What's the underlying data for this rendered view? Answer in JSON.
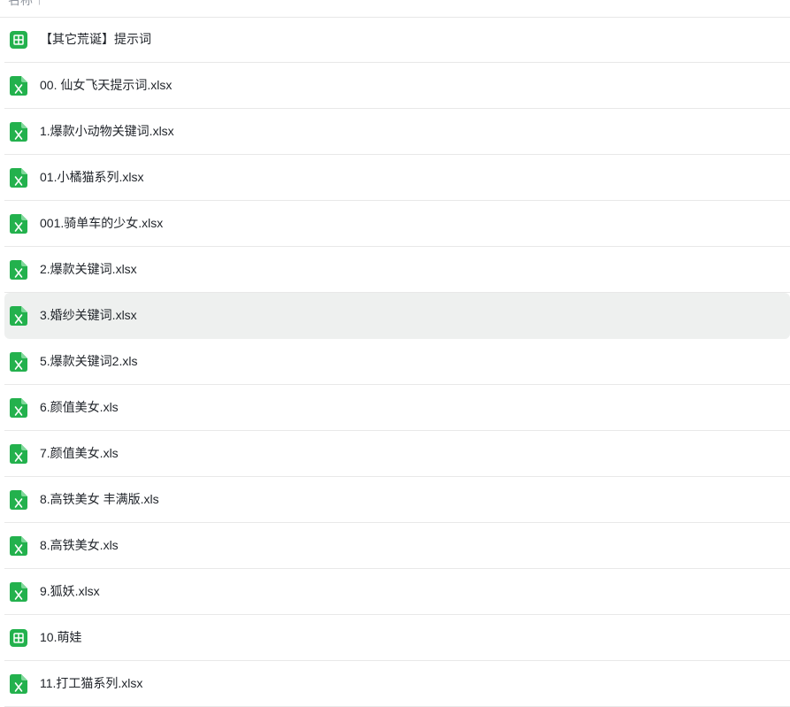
{
  "header": {
    "column_name": "名称 ↑"
  },
  "colors": {
    "file_green": "#23b14d",
    "selected_bg": "#eef0ef",
    "divider": "#e8e8e8"
  },
  "files": [
    {
      "name": "【其它荒诞】提示词",
      "icon": "sheet-icon"
    },
    {
      "name": "00. 仙女飞天提示词.xlsx",
      "icon": "excel-icon"
    },
    {
      "name": "1.爆款小动物关键词.xlsx",
      "icon": "excel-icon"
    },
    {
      "name": "01.小橘猫系列.xlsx",
      "icon": "excel-icon"
    },
    {
      "name": "001.骑单车的少女.xlsx",
      "icon": "excel-icon"
    },
    {
      "name": "2.爆款关键词.xlsx",
      "icon": "excel-icon"
    },
    {
      "name": "3.婚纱关键词.xlsx",
      "icon": "excel-icon",
      "selected": true
    },
    {
      "name": "5.爆款关键词2.xls",
      "icon": "excel-icon"
    },
    {
      "name": "6.颜值美女.xls",
      "icon": "excel-icon"
    },
    {
      "name": "7.颜值美女.xls",
      "icon": "excel-icon"
    },
    {
      "name": "8.高铁美女 丰满版.xls",
      "icon": "excel-icon"
    },
    {
      "name": "8.高铁美女.xls",
      "icon": "excel-icon"
    },
    {
      "name": "9.狐妖.xlsx",
      "icon": "excel-icon"
    },
    {
      "name": "10.萌娃",
      "icon": "sheet-icon"
    },
    {
      "name": "11.打工猫系列.xlsx",
      "icon": "excel-icon"
    }
  ]
}
